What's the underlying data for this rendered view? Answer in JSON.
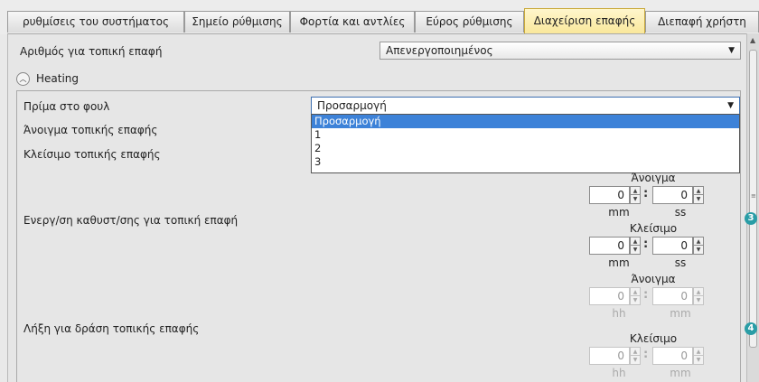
{
  "tabs": [
    {
      "label": "ρυθμίσεις του συστήματος"
    },
    {
      "label": "Σημείο ρύθμισης"
    },
    {
      "label": "Φορτία και αντλίες"
    },
    {
      "label": "Εύρος ρύθμισης"
    },
    {
      "label": "Διαχείριση επαφής"
    },
    {
      "label": "Διεπαφή χρήστη"
    }
  ],
  "active_tab": "Διαχείριση επαφής",
  "contact_number": {
    "label": "Αριθμός για τοπική επαφή",
    "value": "Απενεργοποιημένος"
  },
  "section": {
    "title": "Heating"
  },
  "priming": {
    "label": "Πρίμα στο φουλ",
    "value": "Προσαρμογή",
    "options": [
      "Προσαρμογή",
      "1",
      "2",
      "3"
    ]
  },
  "rows": {
    "open_contact": "Άνοιγμα τοπικής επαφής",
    "close_contact": "Κλείσιμο τοπικής επαφής",
    "delay": "Ενεργ/ση καθυστ/σης για τοπική επαφή",
    "expiry": "Λήξη για δράση τοπικής επαφής"
  },
  "delay": {
    "open": {
      "title": "Άνοιγμα",
      "left_value": "0",
      "right_value": "0",
      "left_unit": "mm",
      "right_unit": "ss"
    },
    "close": {
      "title": "Κλείσιμο",
      "left_value": "0",
      "right_value": "0",
      "left_unit": "mm",
      "right_unit": "ss"
    }
  },
  "expiry": {
    "open": {
      "title": "Άνοιγμα",
      "left_value": "0",
      "right_value": "0",
      "left_unit": "hh",
      "right_unit": "mm"
    },
    "close": {
      "title": "Κλείσιμο",
      "left_value": "0",
      "right_value": "0",
      "left_unit": "hh",
      "right_unit": "mm"
    }
  },
  "markers": {
    "m3": "3",
    "m4": "4"
  },
  "colors": {
    "accent": "#3d82d8",
    "active_tab": "#f9e79a",
    "marker": "#2a9da6"
  }
}
